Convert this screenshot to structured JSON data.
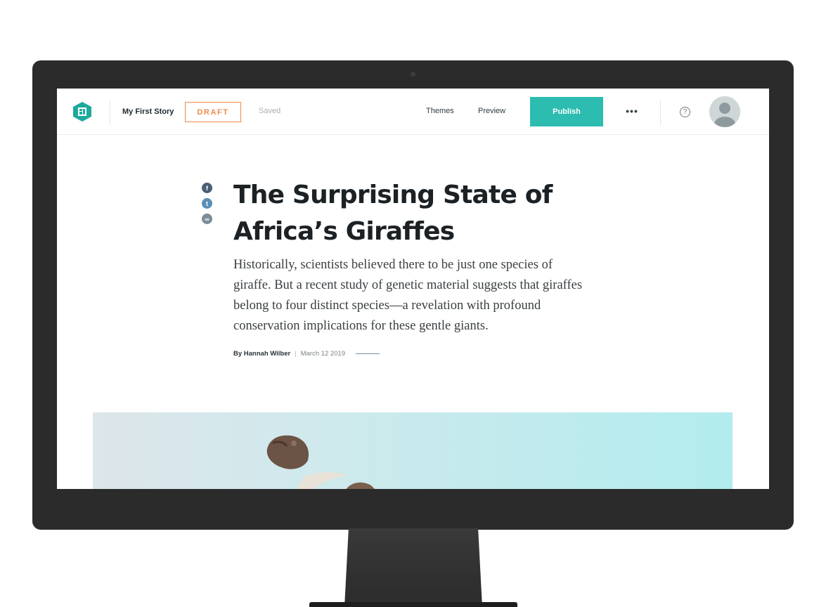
{
  "app": {
    "story_title": "My First Story",
    "status_badge": "DRAFT",
    "save_status": "Saved",
    "nav": {
      "themes": "Themes",
      "preview": "Preview"
    },
    "publish_label": "Publish",
    "more_label": "•••",
    "help_label": "?"
  },
  "colors": {
    "accent": "#2cbcb0",
    "draft": "#ef8a4a",
    "text_dark": "#1b2124"
  },
  "icons": [
    "story-logo-icon",
    "more-icon",
    "help-icon",
    "user-avatar-icon",
    "facebook-icon",
    "twitter-icon",
    "link-icon"
  ],
  "share": {
    "facebook": "f",
    "twitter": "t",
    "link": "∞"
  },
  "article": {
    "title": "The Surprising State of Africa’s Giraffes",
    "summary": "Historically, scientists believed there to be just one species of giraffe. But a recent study of genetic material suggests that giraffes belong to four distinct species—a revelation with profound conservation implications for these gentle giants.",
    "author": "By Hannah Wilber",
    "separator": "|",
    "date": "March 12 2019"
  }
}
